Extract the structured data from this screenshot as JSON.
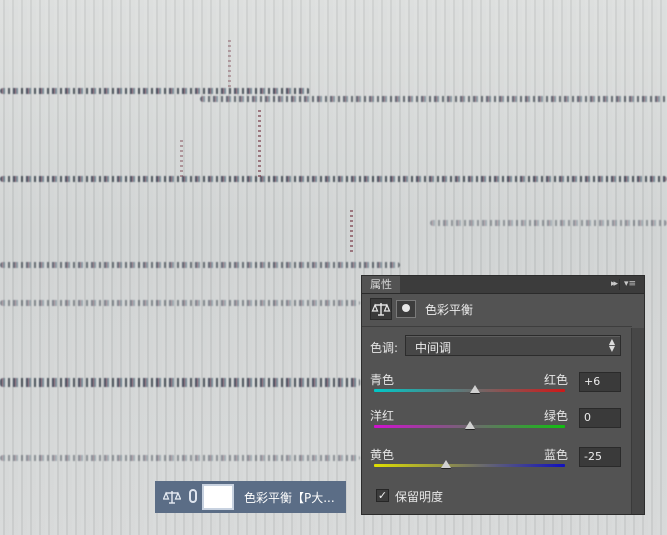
{
  "panel": {
    "tab_title": "属性",
    "collapse_glyph": "▸▸",
    "menu_glyph": "▾≡",
    "adjustment_title": "色彩平衡",
    "tone": {
      "label": "色调:",
      "value": "中间调"
    },
    "sliders": [
      {
        "left_label": "青色",
        "right_label": "红色",
        "value": "+6",
        "level": 0.53
      },
      {
        "left_label": "洋红",
        "right_label": "绿色",
        "value": "0",
        "level": 0.5
      },
      {
        "left_label": "黄色",
        "right_label": "蓝色",
        "value": "-25",
        "level": 0.375
      }
    ],
    "preserve_luminosity": {
      "label": "保留明度",
      "checked": true,
      "check_glyph": "✓"
    }
  },
  "layer_strip": {
    "name": "色彩平衡【P大..."
  },
  "colors": {
    "panel_bg": "#535353",
    "layer_highlight": "#5b6d86",
    "cyan_red_track": [
      "#00c8c8",
      "#d01818"
    ],
    "magenta_green_track": [
      "#d010d0",
      "#10c010"
    ],
    "yellow_blue_track": [
      "#e0e000",
      "#1010c0"
    ]
  },
  "icons": [
    "balance-scale-icon",
    "chain-link-icon",
    "layer-mask-icon",
    "panel-menu-icon",
    "collapse-arrows-icon"
  ]
}
